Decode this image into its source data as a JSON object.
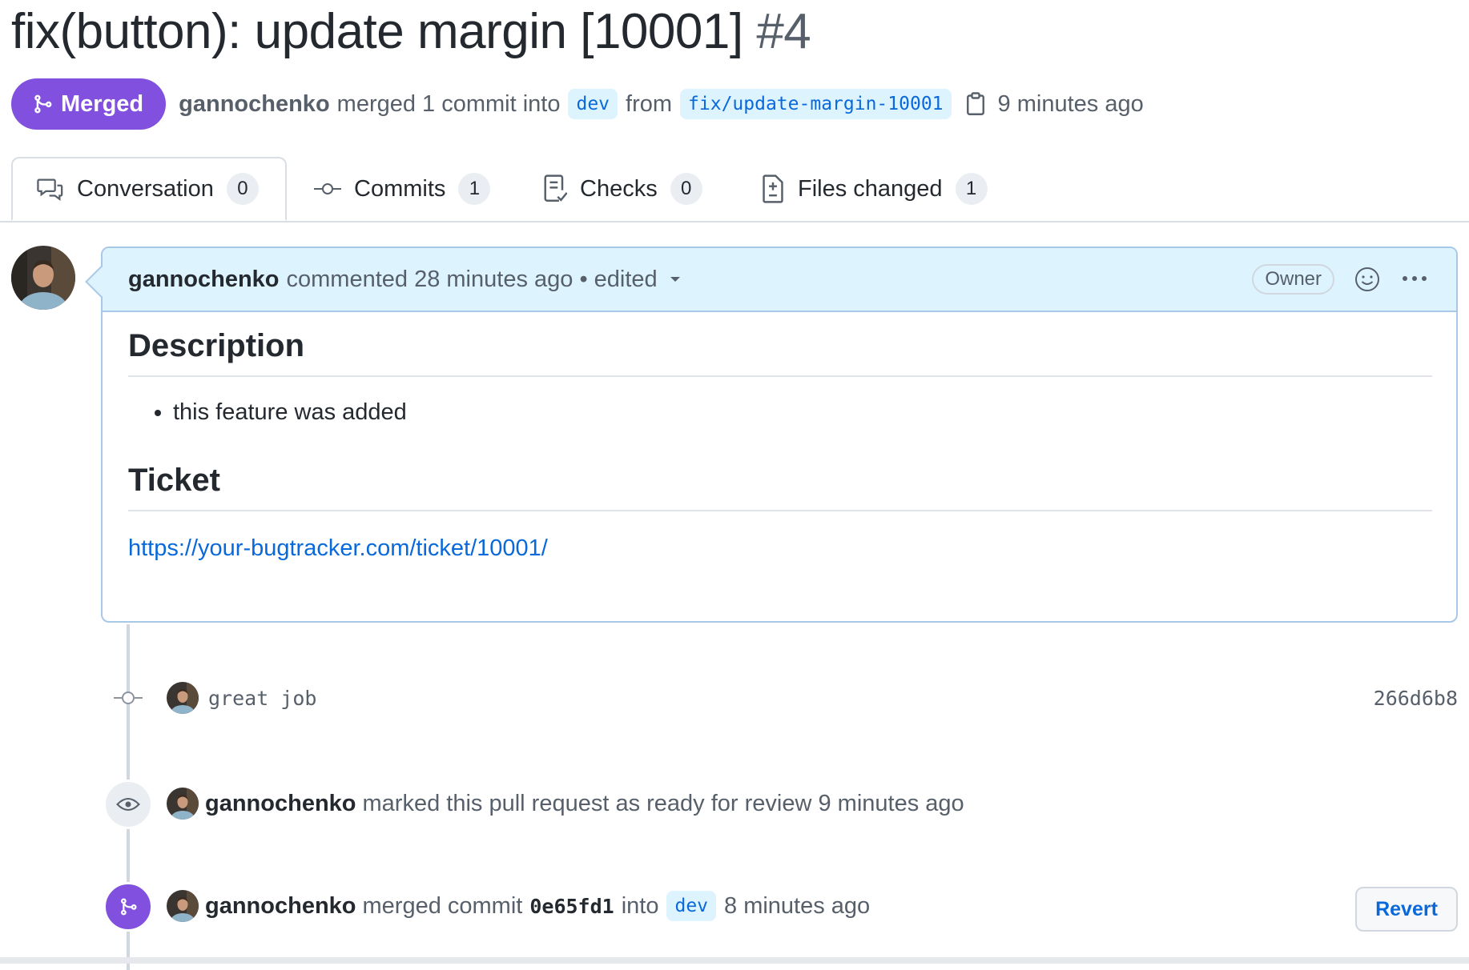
{
  "header": {
    "title": "fix(button): update margin [10001]",
    "number": "#4"
  },
  "status": {
    "badge_label": "Merged",
    "author": "gannochenko",
    "merged_text": "merged 1 commit into",
    "base_branch": "dev",
    "from_text": "from",
    "head_branch": "fix/update-margin-10001",
    "time": "9 minutes ago",
    "badge_color": "#8250df"
  },
  "tabs": [
    {
      "label": "Conversation",
      "count": "0",
      "icon": "comment-discussion-icon"
    },
    {
      "label": "Commits",
      "count": "1",
      "icon": "git-commit-icon"
    },
    {
      "label": "Checks",
      "count": "0",
      "icon": "checklist-icon"
    },
    {
      "label": "Files changed",
      "count": "1",
      "icon": "file-diff-icon"
    }
  ],
  "comment": {
    "author": "gannochenko",
    "meta": "commented 28 minutes ago • edited",
    "owner_label": "Owner",
    "body": {
      "heading1": "Description",
      "bullet": "this feature was added",
      "heading2": "Ticket",
      "link": "https://your-bugtracker.com/ticket/10001/"
    }
  },
  "timeline": {
    "commit": {
      "message": "great job",
      "sha": "266d6b8"
    },
    "ready_event": {
      "author": "gannochenko",
      "text": "marked this pull request as ready for review 9 minutes ago"
    },
    "merge_event": {
      "author": "gannochenko",
      "text_before": "merged commit",
      "sha": "0e65fd1",
      "text_into": "into",
      "branch": "dev",
      "time": "8 minutes ago",
      "revert_label": "Revert"
    }
  }
}
